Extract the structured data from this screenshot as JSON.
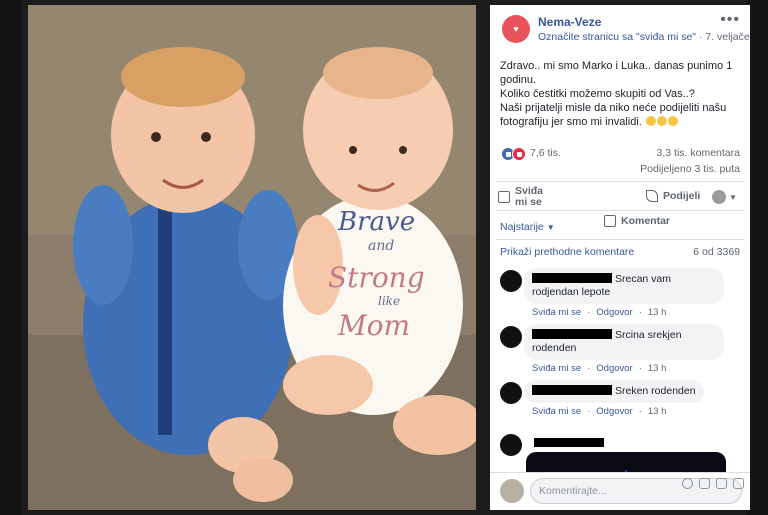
{
  "post": {
    "page_name": "Nema-Veze",
    "avatar_text": "♥",
    "like_page_link": "Označite stranicu sa \"sviđa mi se\"",
    "separator": " · ",
    "date": "7. veljače",
    "more": "•••",
    "text_lines": [
      "Zdravo.. mi smo Marko i Luka.. danas punimo 1 godinu.",
      "Koliko čestitki možemo skupiti od Vas..?",
      "Naši prijatelji misle da niko neće podijeliti našu fotografiju jer smo mi invalidi."
    ]
  },
  "stats": {
    "reactions": "7,6 tis.",
    "comments": "3,3 tis. komentara",
    "shares": "Podijeljeno 3 tis. puta"
  },
  "actions": {
    "like": "Sviđa mi se",
    "comment": "Komentar",
    "share": "Podijeli"
  },
  "comments_section": {
    "sort_label": "Najstarije",
    "previous_link": "Prikaži prethodne komentare",
    "counter": "6 od 3369",
    "like_link": "Sviđa mi se",
    "reply_link": "Odgovor",
    "items": [
      {
        "text": "Srecan vam rodjendan lepote",
        "time": "13 h"
      },
      {
        "text": "Srcina srekjen rodenden",
        "time": "13 h"
      },
      {
        "text": "Sreken rodenden",
        "time": "13 h"
      }
    ]
  },
  "composer": {
    "placeholder": "Komentirajte..."
  },
  "photo": {
    "shirt_text": [
      "Brave",
      "and",
      "Strong",
      "like",
      "Mom"
    ]
  },
  "colors": {
    "link": "#385898",
    "like_reaction": "#4267b2",
    "love_reaction": "#f0284a"
  }
}
